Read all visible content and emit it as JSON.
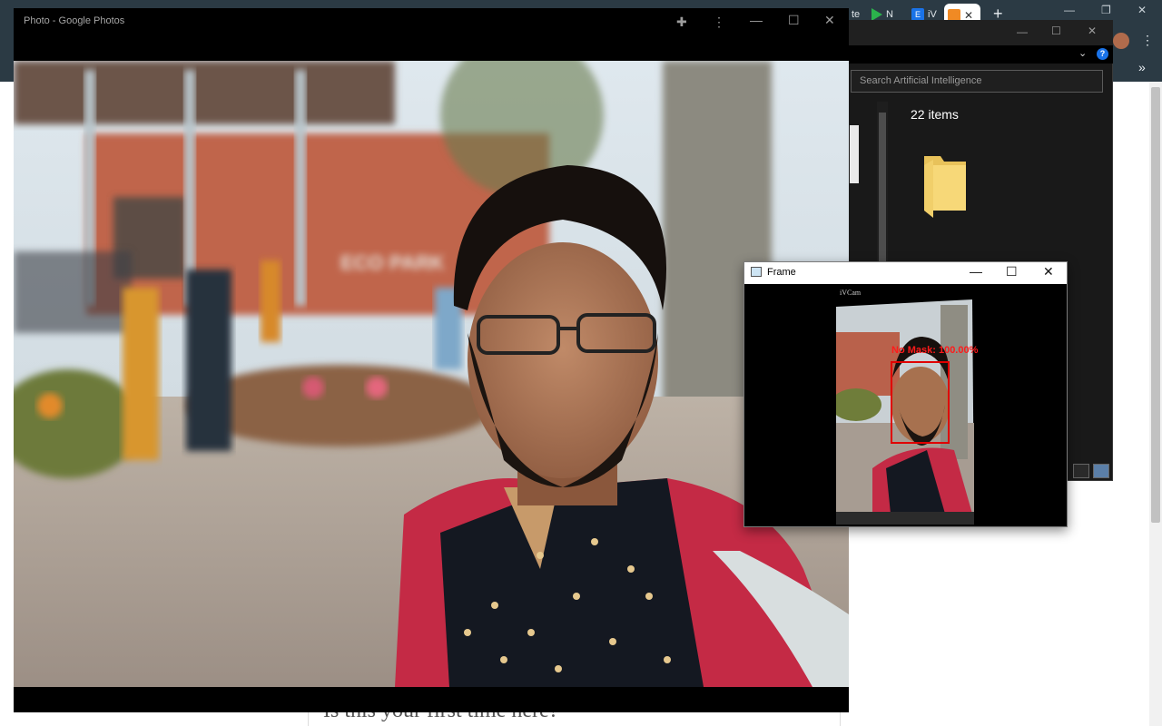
{
  "chrome": {
    "tabs": [
      {
        "label": "te",
        "favicon_color": "#ffffff"
      },
      {
        "label": "N",
        "favicon_color": "#2bb24c"
      },
      {
        "label": "iV",
        "favicon_color": "#1a73e8"
      }
    ],
    "active_tab_favicon": "analytics-icon",
    "new_tab_label": "+",
    "extensions_chevron": "»",
    "page_heading": "Is this your first time here?"
  },
  "explorer": {
    "search_placeholder": "Search Artificial Intelligence",
    "item_count": "22 items",
    "help_label": "?"
  },
  "photos": {
    "window_title": "Photo - Google Photos",
    "scene_sign": "ECO PARK"
  },
  "frame": {
    "window_title": "Frame",
    "camera_label": "iVCam",
    "detection_label": "No Mask: 100.00%"
  },
  "icons": {
    "puzzle": "puzzle-icon",
    "more": "more-vert-icon",
    "minimize": "minimize-icon",
    "maximize": "maximize-icon",
    "close": "close-icon",
    "folder": "folder-icon"
  }
}
